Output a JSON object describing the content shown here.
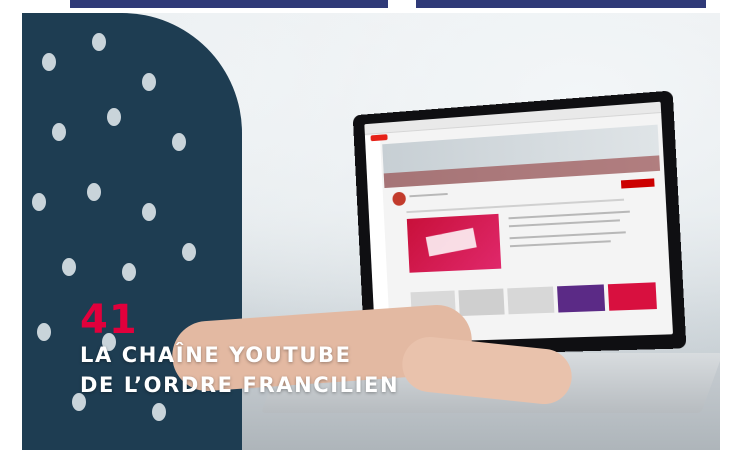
{
  "caption": {
    "number": "41",
    "title_line_1": "LA CHAÎNE YOUTUBE",
    "title_line_2": "DE L’ORDRE FRANCILIEN"
  },
  "colors": {
    "accent_number": "#e1003c",
    "title_text": "#ffffff",
    "top_band": "#2f3a78"
  },
  "photo": {
    "icon": "laptop-youtube-channel-photo"
  }
}
